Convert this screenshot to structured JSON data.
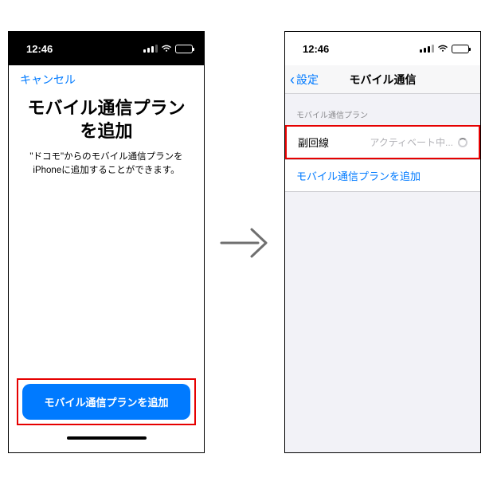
{
  "statusbar": {
    "time": "12:46"
  },
  "leftScreen": {
    "cancel": "キャンセル",
    "title": "モバイル通信プランを追加",
    "subtitle": "\"ドコモ\"からのモバイル通信プランをiPhoneに追加することができます。",
    "primaryButton": "モバイル通信プランを追加"
  },
  "rightScreen": {
    "back": "設定",
    "navTitle": "モバイル通信",
    "sectionHeader": "モバイル通信プラン",
    "plan": {
      "label": "副回線",
      "status": "アクティベート中..."
    },
    "addPlan": "モバイル通信プランを追加"
  }
}
